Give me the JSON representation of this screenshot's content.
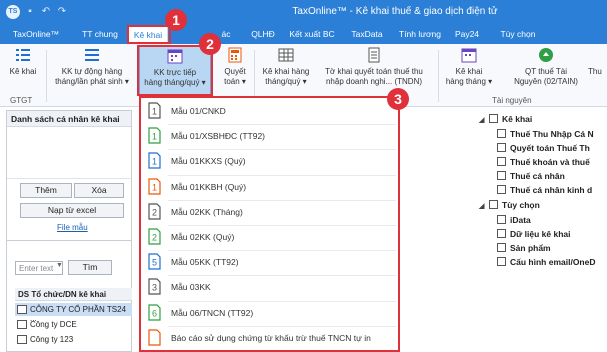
{
  "window": {
    "title": "TaxOnline™ - Kê khai thuế & giao dịch điện tử",
    "logo": "TS"
  },
  "tabs": [
    {
      "label": "TaxOnline™"
    },
    {
      "label": "TT chung"
    },
    {
      "label": "Kê khai"
    },
    {
      "label": "ác"
    },
    {
      "label": "QLHĐ"
    },
    {
      "label": "Kết xuất BC"
    },
    {
      "label": "TaxData"
    },
    {
      "label": "Tính lương"
    },
    {
      "label": "Pay24"
    },
    {
      "label": "Tùy chọn"
    }
  ],
  "ribbon": {
    "ke_khai": "Kê khai",
    "kk_tu_dong_1": "KK tự động hàng",
    "kk_tu_dong_2": "tháng/lần phát sinh ▾",
    "kk_truc_tiep_1": "KK trực tiếp",
    "kk_truc_tiep_2": "hàng tháng/quý ▾",
    "quyet_toan_1": "Quyết",
    "quyet_toan_2": "toán ▾",
    "ke_khai_hang_1": "Kê khai hàng",
    "ke_khai_hang_2": "tháng/quý ▾",
    "to_khai_qt_1": "Tờ khai quyết toán thuế thu",
    "to_khai_qt_2": "nhập doanh nghi... (TNDN)",
    "kk_hang_thang_1": "Kê khai",
    "kk_hang_thang_2": "hàng tháng ▾",
    "qt_thue_1": "QT thuế Tài",
    "qt_thue_2": "Nguyên (02/TAIN)",
    "thu_cut": "Thu",
    "group_gtgt": "GTGT",
    "group_tai_nguyen": "Tài nguyên"
  },
  "left_panel": {
    "header": "Danh sách cá nhân kê khai",
    "them": "Thêm",
    "xoa": "Xóa",
    "nap_excel": "Nạp từ excel",
    "file_mau": "File mẫu",
    "filter_placeholder": "Enter text",
    "tim": "Tìm",
    "org_header": "DS Tổ chức/DN kê khai",
    "orgs": [
      "CÔNG TY CỔ PHẦN TS24 ...",
      "Công ty DCE",
      "Công ty 123"
    ]
  },
  "menu": {
    "items": [
      {
        "label": "Mẫu 01/CNKD",
        "icon_num": "1",
        "icon_color": "#555555"
      },
      {
        "label": "Mẫu 01/XSBHĐC (TT92)",
        "icon_num": "1",
        "icon_color": "#2f9e44"
      },
      {
        "label": "Mẫu 01KKXS (Quý)",
        "icon_num": "1",
        "icon_color": "#1f6fd1"
      },
      {
        "label": "Mẫu 01KKBH (Quý)",
        "icon_num": "1",
        "icon_color": "#e8590c"
      },
      {
        "label": "Mẫu 02KK (Tháng)",
        "icon_num": "2",
        "icon_color": "#555555"
      },
      {
        "label": "Mẫu 02KK (Quý)",
        "icon_num": "2",
        "icon_color": "#2f9e44"
      },
      {
        "label": "Mẫu 05KK (TT92)",
        "icon_num": "5",
        "icon_color": "#1f6fd1"
      },
      {
        "label": "Mẫu 03KK",
        "icon_num": "3",
        "icon_color": "#555555"
      },
      {
        "label": "Mẫu 06/TNCN (TT92)",
        "icon_num": "6",
        "icon_color": "#2f9e44"
      },
      {
        "label": "Báo cáo sử dụng chứng từ khấu trừ thuế TNCN tự in",
        "icon_num": "",
        "icon_color": "#e8590c"
      }
    ]
  },
  "tree": {
    "ke_khai": "Kê khai",
    "items_ke_khai": [
      "Thuế Thu Nhập Cá N",
      "Quyết toán Thuế Th",
      "Thuế khoán và thuế",
      "Thuế cá nhân",
      "Thuế cá nhân kinh d"
    ],
    "tuy_chon": "Tùy chọn",
    "items_tuy_chon": [
      "iData",
      "Dữ liệu kê khai",
      "Sản phẩm",
      "Cấu hình email/OneD"
    ]
  },
  "callouts": [
    "1",
    "2",
    "3"
  ],
  "colors": {
    "brand": "#2b7fd6",
    "highlight": "#e0303a"
  }
}
